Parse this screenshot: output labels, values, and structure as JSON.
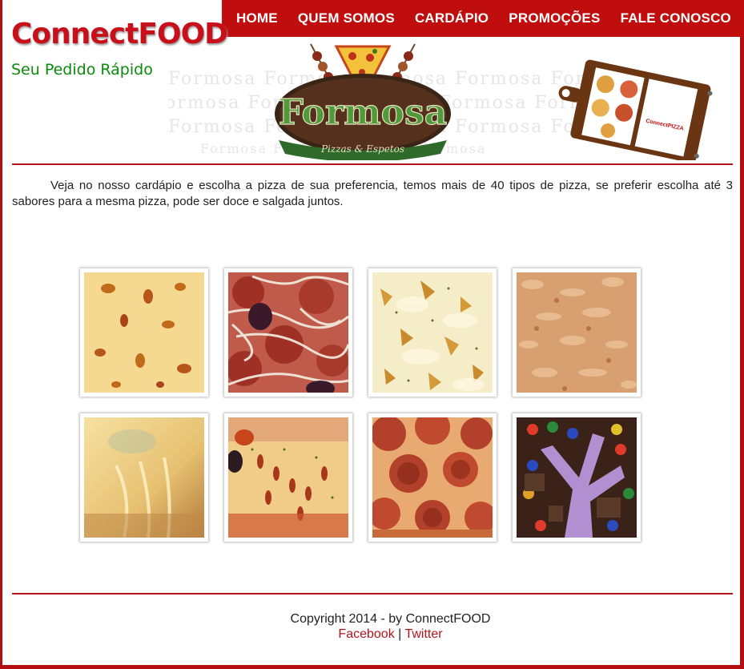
{
  "brand": {
    "name": "ConnectFOOD",
    "tagline": "Seu Pedido Rápido"
  },
  "nav": {
    "items": [
      {
        "label": "HOME"
      },
      {
        "label": "QUEM SOMOS"
      },
      {
        "label": "CARDÁPIO"
      },
      {
        "label": "PROMOÇÕES"
      },
      {
        "label": "FALE CONOSCO"
      }
    ]
  },
  "banner": {
    "logo_title": "Formosa",
    "logo_subtitle": "Pizzas & Espetos",
    "watermark": "Formosa",
    "menu_board_label": "ConnectPIZZA"
  },
  "intro": {
    "text": "Veja no nosso cardápio e escolha a pizza de sua preferencia, temos mais de 40 tipos de pizza, se preferir escolha até 3 sabores para a mesma pizza, pode ser doce e salgada juntos."
  },
  "gallery": {
    "items": [
      {
        "name": "pizza-cheese-photo"
      },
      {
        "name": "pizza-pepperoni-olive-photo"
      },
      {
        "name": "pizza-chicken-cheese-photo"
      },
      {
        "name": "pizza-tuna-photo"
      },
      {
        "name": "pizza-four-cheese-photo"
      },
      {
        "name": "pizza-olive-oregano-photo"
      },
      {
        "name": "pizza-pepperoni-photo"
      },
      {
        "name": "pizza-chocolate-photo"
      }
    ]
  },
  "footer": {
    "copyright": "Copyright 2014 - by ConnectFOOD",
    "facebook": "Facebook",
    "separator": "|",
    "twitter": "Twitter"
  },
  "colors": {
    "accent": "#c00d0d",
    "tagline": "#0a8a0a",
    "link": "#b3141a"
  }
}
